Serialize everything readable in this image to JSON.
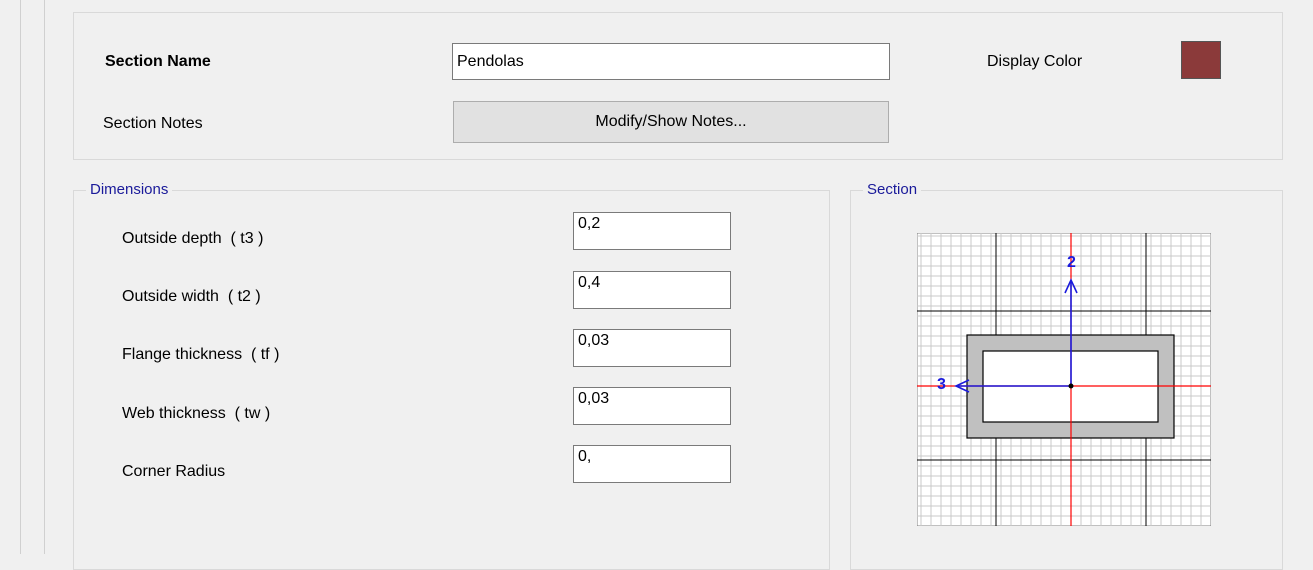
{
  "section_name": {
    "label": "Section Name",
    "value": "Pendolas"
  },
  "display_color": {
    "label": "Display Color",
    "color": "#8b3a3a"
  },
  "section_notes": {
    "label": "Section Notes",
    "button_label": "Modify/Show Notes..."
  },
  "dimensions": {
    "title": "Dimensions",
    "fields": [
      {
        "label": "Outside depth  ( t3 )",
        "value": "0,2"
      },
      {
        "label": "Outside width  ( t2 )",
        "value": "0,4"
      },
      {
        "label": "Flange thickness  ( tf )",
        "value": "0,03"
      },
      {
        "label": "Web thickness  ( tw )",
        "value": "0,03"
      },
      {
        "label": "Corner Radius",
        "value": "0,"
      }
    ]
  },
  "section_preview": {
    "title": "Section",
    "axis_2_label": "2",
    "axis_3_label": "3",
    "axis_color": "#1a1adc",
    "centerline_color": "#ff0000",
    "section_fill": "#c0c0c0"
  }
}
